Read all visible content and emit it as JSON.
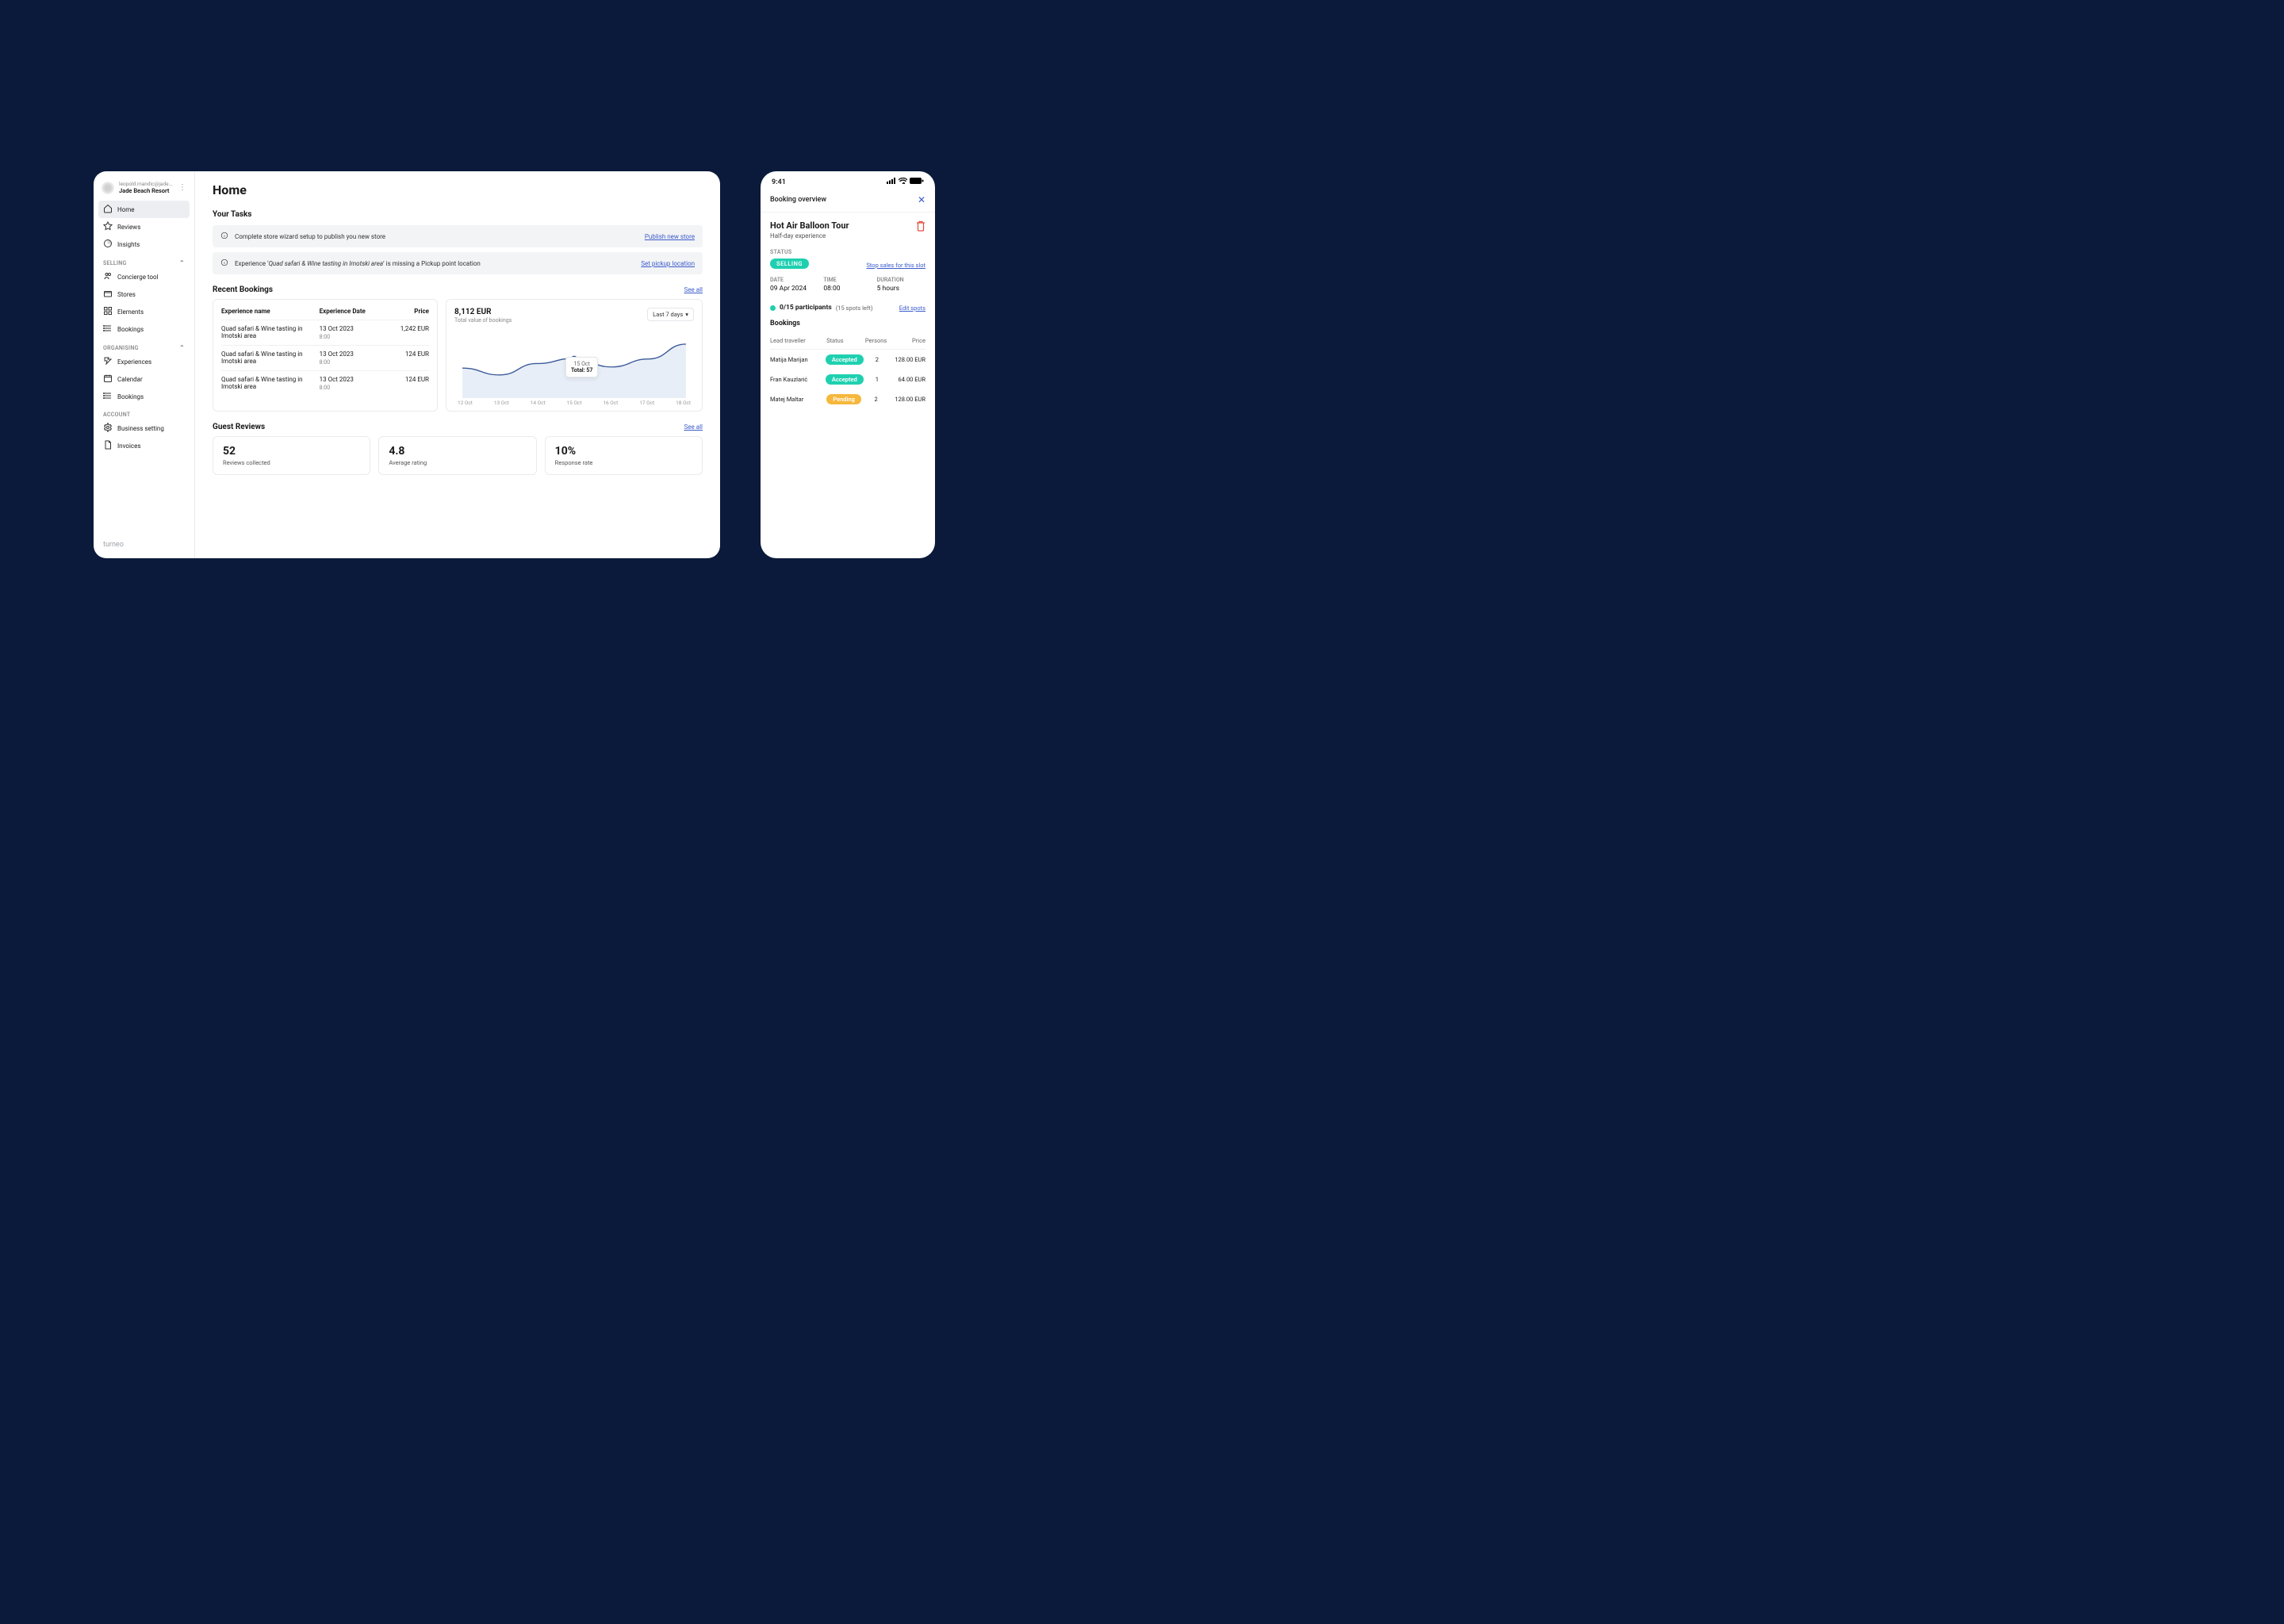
{
  "desktop": {
    "account": {
      "email": "leopold.mandic@jade...",
      "name": "Jade Beach Resort"
    },
    "nav_top": [
      {
        "icon": "home-icon",
        "label": "Home",
        "active": true
      },
      {
        "icon": "star-icon",
        "label": "Reviews"
      },
      {
        "icon": "insights-icon",
        "label": "Insights"
      }
    ],
    "sections": [
      {
        "label": "SELLING",
        "items": [
          {
            "icon": "concierge-icon",
            "label": "Concierge tool"
          },
          {
            "icon": "stores-icon",
            "label": "Stores"
          },
          {
            "icon": "elements-icon",
            "label": "Elements"
          },
          {
            "icon": "bookings-icon",
            "label": "Bookings"
          }
        ]
      },
      {
        "label": "ORGANISING",
        "items": [
          {
            "icon": "experiences-icon",
            "label": "Experiences"
          },
          {
            "icon": "calendar-icon",
            "label": "Calendar"
          },
          {
            "icon": "bookings-icon",
            "label": "Bookings"
          }
        ]
      },
      {
        "label": "ACCOUNT",
        "items": [
          {
            "icon": "settings-icon",
            "label": "Business setting"
          },
          {
            "icon": "invoices-icon",
            "label": "Invoices"
          }
        ]
      }
    ],
    "brand": "turneo",
    "page_title": "Home",
    "tasks": {
      "heading": "Your Tasks",
      "items": [
        {
          "text_before": "Complete store wizard setup to publish you new store",
          "emph": "",
          "text_after": "",
          "action": "Publish new store"
        },
        {
          "text_before": "Experience ‘",
          "emph": "Quad safari &  Wine tasting in Imotski area",
          "text_after": "’ is missing a Pickup point location",
          "action": "Set pickup location"
        }
      ]
    },
    "recent": {
      "heading": "Recent Bookings",
      "see_all": "See all",
      "cols": {
        "name": "Experience name",
        "date": "Experience Date",
        "price": "Price"
      },
      "rows": [
        {
          "name": "Quad safari &  Wine tasting in Imotski area",
          "date": "13 Oct 2023",
          "time": "8:00",
          "price": "1,242 EUR"
        },
        {
          "name": "Quad safari &  Wine tasting in Imotski area",
          "date": "13 Oct 2023",
          "time": "8:00",
          "price": "124 EUR"
        },
        {
          "name": "Quad safari &  Wine tasting in Imotski area",
          "date": "13 Oct 2023",
          "time": "8:00",
          "price": "124 EUR"
        }
      ]
    },
    "chart": {
      "value": "8,112 EUR",
      "subtitle": "Total value of bookings",
      "range": "Last 7 days",
      "tooltip_date": "15 Oct",
      "tooltip_total": "Total: 57"
    },
    "reviews": {
      "heading": "Guest Reviews",
      "see_all": "See all",
      "cards": [
        {
          "num": "52",
          "label": "Reviews collected"
        },
        {
          "num": "4.8",
          "label": "Average rating"
        },
        {
          "num": "10%",
          "label": "Response rate"
        }
      ]
    }
  },
  "mobile": {
    "time": "9:41",
    "header": "Booking overview",
    "title": "Hot Air Balloon Tour",
    "subtitle": "Half-day experience",
    "status_label": "STATUS",
    "status_badge": "SELLING",
    "stop_link": "Stop sales for this slot",
    "info": {
      "date_label": "DATE",
      "date_val": "09 Apr 2024",
      "time_label": "TIME",
      "time_val": "08:00",
      "dur_label": "DURATION",
      "dur_val": "5 hours"
    },
    "participants": {
      "main": "0/15 participants",
      "note": "(15 spots left)",
      "edit": "Edit spots"
    },
    "bookings_heading": "Bookings",
    "cols": {
      "trav": "Lead traveller",
      "status": "Status",
      "persons": "Persons",
      "price": "Price"
    },
    "rows": [
      {
        "trav": "Matija Marijan",
        "status": "Accepted",
        "status_class": "accepted",
        "persons": "2",
        "price": "128.00 EUR"
      },
      {
        "trav": "Fran Kauzlarić",
        "status": "Accepted",
        "status_class": "accepted",
        "persons": "1",
        "price": "64.00 EUR"
      },
      {
        "trav": "Matej Maltar",
        "status": "Pending",
        "status_class": "pending",
        "persons": "2",
        "price": "128.00 EUR"
      }
    ]
  },
  "chart_data": {
    "type": "line",
    "categories": [
      "12 Oct",
      "13 Oct",
      "14 Oct",
      "15 Oct",
      "16 Oct",
      "17 Oct",
      "18 Oct"
    ],
    "values": [
      40,
      28,
      48,
      57,
      42,
      56,
      82
    ],
    "title": "Total value of bookings",
    "xlabel": "",
    "ylabel": "",
    "ylim": [
      0,
      100
    ],
    "highlight": {
      "x": "15 Oct",
      "y": 57
    }
  }
}
